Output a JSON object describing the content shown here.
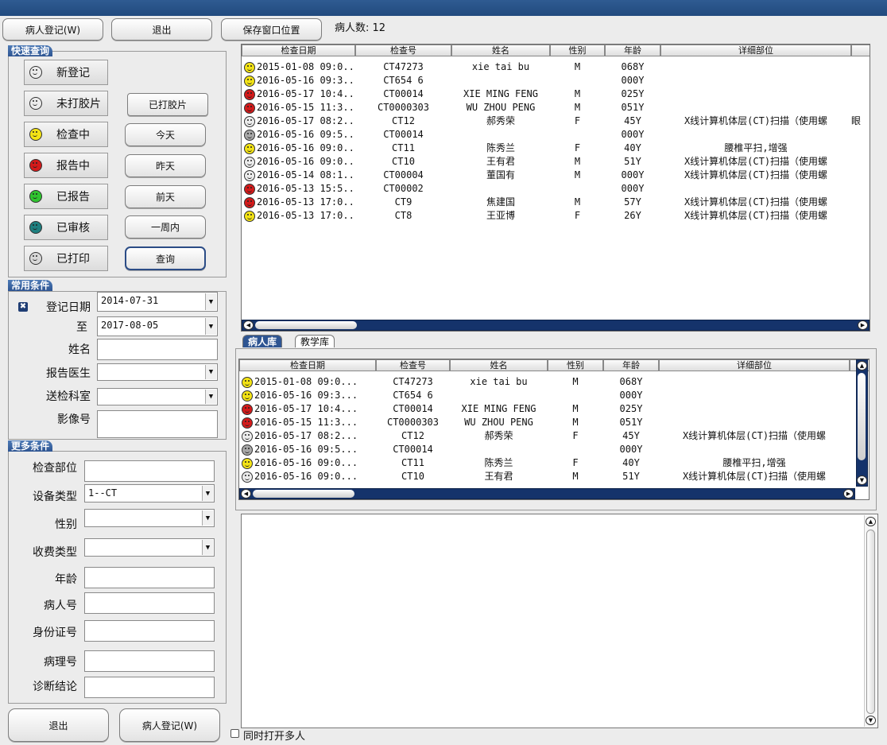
{
  "toolbar": {
    "register": "病人登记(W)",
    "exit": "退出",
    "save_pos": "保存窗口位置",
    "patient_count": "病人数: 12"
  },
  "quick": {
    "title": "快速查询",
    "items": [
      {
        "label": "新登记",
        "color": "#ececec"
      },
      {
        "label": "未打胶片",
        "color": "#ececec"
      },
      {
        "label": "检查中",
        "color": "#f3e315"
      },
      {
        "label": "报告中",
        "color": "#d41a1a"
      },
      {
        "label": "已报告",
        "color": "#2fc42f"
      },
      {
        "label": "已审核",
        "color": "#1e7f7f"
      },
      {
        "label": "已打印",
        "color": "#d8d8d8"
      }
    ],
    "right_buttons": [
      "已打胶片",
      "今天",
      "昨天",
      "前天",
      "一周内",
      "查询"
    ]
  },
  "common": {
    "title": "常用条件",
    "reg_date_label": "登记日期",
    "to_label": "至",
    "date_from": "2014-07-31",
    "date_to": "2017-08-05",
    "name_label": "姓名",
    "doctor_label": "报告医生",
    "dept_label": "送检科室",
    "image_label": "影像号"
  },
  "more": {
    "title": "更多条件",
    "part_label": "检查部位",
    "device_label": "设备类型",
    "device_value": "1--CT",
    "sex_label": "性别",
    "fee_label": "收费类型",
    "age_label": "年龄",
    "pid_label": "病人号",
    "idcard_label": "身份证号",
    "path_label": "病理号",
    "diag_label": "诊断结论"
  },
  "bottom": {
    "exit": "退出",
    "register": "病人登记(W)",
    "multi_open": "同时打开多人"
  },
  "columns": [
    "检查日期",
    "检查号",
    "姓名",
    "性别",
    "年龄",
    "详细部位"
  ],
  "rows": [
    {
      "color": "#f3e315",
      "date": "2015-01-08 09:0...",
      "no": "CT47273",
      "name": "xie tai bu",
      "sex": "M",
      "age": "068Y",
      "detail": ""
    },
    {
      "color": "#f3e315",
      "date": "2016-05-16 09:3...",
      "no": "CT654 6",
      "name": "",
      "sex": "",
      "age": "000Y",
      "detail": ""
    },
    {
      "color": "#d41a1a",
      "date": "2016-05-17 10:4...",
      "no": "CT00014",
      "name": "XIE MING FENG",
      "sex": "M",
      "age": "025Y",
      "detail": ""
    },
    {
      "color": "#d41a1a",
      "date": "2016-05-15 11:3...",
      "no": "CT0000303",
      "name": "WU ZHOU PENG",
      "sex": "M",
      "age": "051Y",
      "detail": ""
    },
    {
      "color": "#ececec",
      "date": "2016-05-17 08:2...",
      "no": "CT12",
      "name": "郝秀荣",
      "sex": "F",
      "age": "45Y",
      "detail": "X线计算机体层(CT)扫描（使用螺"
    },
    {
      "color": "#a8a8a8",
      "date": "2016-05-16 09:5...",
      "no": "CT00014",
      "name": "",
      "sex": "",
      "age": "000Y",
      "detail": ""
    },
    {
      "color": "#f3e315",
      "date": "2016-05-16 09:0...",
      "no": "CT11",
      "name": "陈秀兰",
      "sex": "F",
      "age": "40Y",
      "detail": "腰椎平扫,增强"
    },
    {
      "color": "#ececec",
      "date": "2016-05-16 09:0...",
      "no": "CT10",
      "name": "王有君",
      "sex": "M",
      "age": "51Y",
      "detail": "X线计算机体层(CT)扫描（使用螺"
    },
    {
      "color": "#ececec",
      "date": "2016-05-14 08:1...",
      "no": "CT00004",
      "name": "董国有",
      "sex": "M",
      "age": "000Y",
      "detail": "X线计算机体层(CT)扫描（使用螺"
    },
    {
      "color": "#d41a1a",
      "date": "2016-05-13 15:5...",
      "no": "CT00002",
      "name": "",
      "sex": "",
      "age": "000Y",
      "detail": ""
    },
    {
      "color": "#d41a1a",
      "date": "2016-05-13 17:0...",
      "no": "CT9",
      "name": "焦建国",
      "sex": "M",
      "age": "57Y",
      "detail": "X线计算机体层(CT)扫描（使用螺"
    },
    {
      "color": "#f3e315",
      "date": "2016-05-13 17:0...",
      "no": "CT8",
      "name": "王亚博",
      "sex": "F",
      "age": "26Y",
      "detail": "X线计算机体层(CT)扫描（使用螺"
    }
  ],
  "row4_extra": "眼",
  "tabs": [
    "病人库",
    "教学库"
  ]
}
